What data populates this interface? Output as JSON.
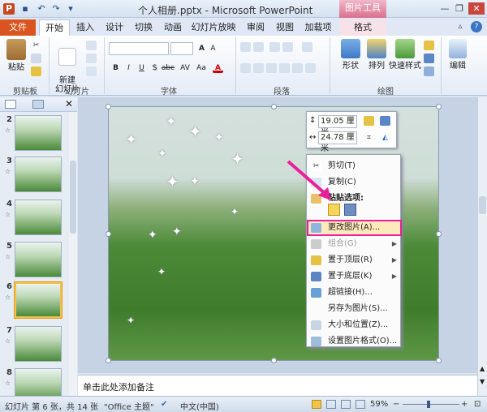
{
  "title_bar": {
    "title": "个人相册.pptx - Microsoft PowerPoint",
    "context_tool": "图片工具",
    "quick_access": [
      "P",
      "save",
      "undo",
      "redo",
      "customize"
    ]
  },
  "tabs": [
    {
      "label": "文件"
    },
    {
      "label": "开始"
    },
    {
      "label": "插入"
    },
    {
      "label": "设计"
    },
    {
      "label": "切换"
    },
    {
      "label": "动画"
    },
    {
      "label": "幻灯片放映"
    },
    {
      "label": "审阅"
    },
    {
      "label": "视图"
    },
    {
      "label": "加载项"
    },
    {
      "label": "格式"
    }
  ],
  "ribbon": {
    "paste_label": "粘贴",
    "new_slide_label": "新建\n幻灯片",
    "shape_label": "形状",
    "arrange_label": "排列",
    "quick_styles_label": "快速样式",
    "edit_label": "编辑",
    "groups": [
      "剪贴板",
      "幻灯片",
      "字体",
      "段落",
      "绘图"
    ],
    "font_buttons": [
      "B",
      "I",
      "U",
      "S",
      "abc",
      "AV",
      "Aa",
      "A",
      "A"
    ]
  },
  "slides": [
    {
      "num": "2"
    },
    {
      "num": "3"
    },
    {
      "num": "4"
    },
    {
      "num": "5"
    },
    {
      "num": "6"
    },
    {
      "num": "7"
    },
    {
      "num": "8"
    }
  ],
  "selected_slide": "6",
  "size_box": {
    "height": "19.05 厘米",
    "width": "24.78 厘米"
  },
  "context_menu": {
    "items": [
      {
        "label": "剪切(T)",
        "icon": "scissors-icon",
        "disabled": false
      },
      {
        "label": "复制(C)",
        "icon": "copy-icon",
        "disabled": false
      },
      {
        "label": "粘贴选项:",
        "icon": "paste-icon",
        "disabled": false
      },
      {
        "label": "更改图片(A)...",
        "icon": "change-picture-icon",
        "disabled": false
      },
      {
        "label": "组合(G)",
        "icon": "group-icon",
        "disabled": true
      },
      {
        "label": "置于顶层(R)",
        "icon": "bring-front-icon",
        "disabled": false
      },
      {
        "label": "置于底层(K)",
        "icon": "send-back-icon",
        "disabled": false
      },
      {
        "label": "超链接(H)...",
        "icon": "hyperlink-icon",
        "disabled": false
      },
      {
        "label": "另存为图片(S)...",
        "icon": "",
        "disabled": false
      },
      {
        "label": "大小和位置(Z)...",
        "icon": "size-icon",
        "disabled": false
      },
      {
        "label": "设置图片格式(O)...",
        "icon": "format-picture-icon",
        "disabled": false
      }
    ]
  },
  "notes_placeholder": "单击此处添加备注",
  "status": {
    "slide_info": "幻灯片 第 6 张，共 14 张",
    "theme": "\"Office 主题\"",
    "language": "中文(中国)",
    "zoom": "59%"
  },
  "colors": {
    "file_tab": "#d9541e",
    "highlight": "#e8209a",
    "arrow": "#e8209a"
  }
}
